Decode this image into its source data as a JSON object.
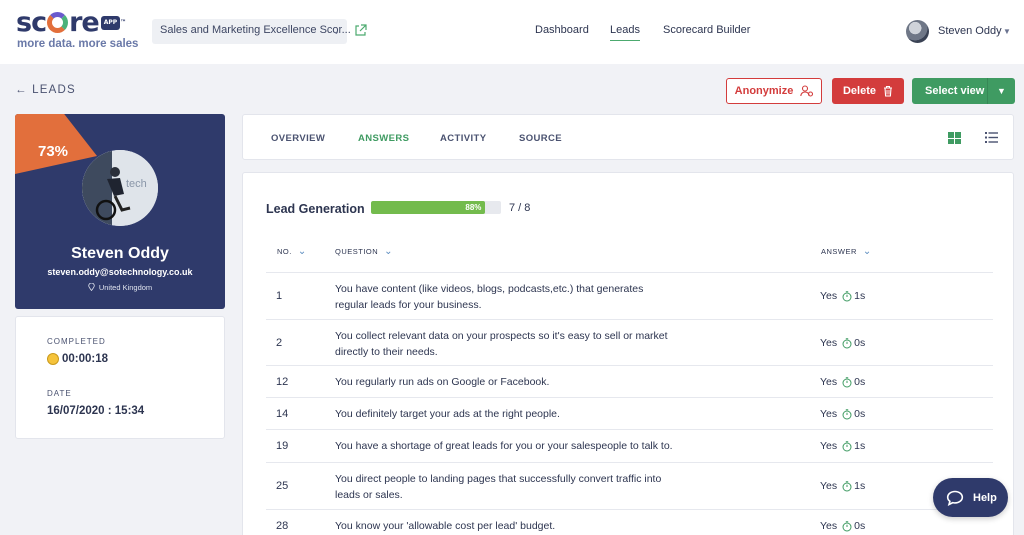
{
  "app": {
    "logo_word_pre": "sc",
    "logo_word_post": "re",
    "logo_app": "APP",
    "logo_tm": "™",
    "tagline": "more data. more sales"
  },
  "scorecard_select": {
    "value": "Sales and Marketing Excellence Scor..."
  },
  "nav": {
    "dashboard": "Dashboard",
    "leads": "Leads",
    "scorecard_builder": "Scorecard Builder",
    "active": "Leads"
  },
  "user": {
    "name": "Steven Oddy"
  },
  "breadcrumb": {
    "back_label": "LEADS"
  },
  "actions": {
    "anonymize": "Anonymize",
    "delete": "Delete",
    "select_view": "Select view"
  },
  "profile": {
    "score": "73%",
    "name": "Steven Oddy",
    "email": "steven.oddy@sotechnology.co.uk",
    "location": "United Kingdom"
  },
  "stats": {
    "completed_label": "COMPLETED",
    "completed_value": "00:00:18",
    "date_label": "DATE",
    "date_value": "16/07/2020 : 15:34"
  },
  "tabs": {
    "overview": "OVERVIEW",
    "answers": "ANSWERS",
    "activity": "ACTIVITY",
    "source": "SOURCE",
    "active": "ANSWERS"
  },
  "section": {
    "title": "Lead Generation",
    "progress_percent": 88,
    "progress_label": "88%",
    "progress_count": "7 / 8"
  },
  "table": {
    "headers": {
      "no": "NO.",
      "question": "QUESTION",
      "answer": "ANSWER"
    },
    "rows": [
      {
        "no": "1",
        "question": "You have content (like videos, blogs, podcasts,etc.) that generates regular leads for your business.",
        "answer": "Yes",
        "time": "1s"
      },
      {
        "no": "2",
        "question": "You collect relevant data on your prospects so it's easy to sell or market directly to their needs.",
        "answer": "Yes",
        "time": "0s"
      },
      {
        "no": "12",
        "question": "You regularly run ads on Google or Facebook.",
        "answer": "Yes",
        "time": "0s"
      },
      {
        "no": "14",
        "question": "You definitely target your ads at the right people.",
        "answer": "Yes",
        "time": "0s"
      },
      {
        "no": "19",
        "question": "You have a shortage of great leads for you or your salespeople to talk to.",
        "answer": "Yes",
        "time": "1s"
      },
      {
        "no": "25",
        "question": "You direct people to landing pages that successfully convert traffic into leads or sales.",
        "answer": "Yes",
        "time": "1s"
      },
      {
        "no": "28",
        "question": "You know your 'allowable cost per lead' budget.",
        "answer": "Yes",
        "time": "0s"
      }
    ]
  },
  "help": {
    "label": "Help"
  },
  "colors": {
    "navy": "#2f3a6b",
    "orange": "#e26f3c",
    "green": "#3f9b62",
    "red": "#d33c3c",
    "progress": "#73bb4d"
  }
}
